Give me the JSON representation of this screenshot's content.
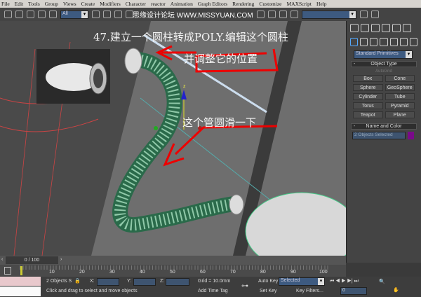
{
  "menu": [
    "File",
    "Edit",
    "Tools",
    "Group",
    "Views",
    "Create",
    "Modifiers",
    "Character",
    "reactor",
    "Animation",
    "Graph Editors",
    "Rendering",
    "Customize",
    "MAXScript",
    "Help"
  ],
  "toolbar": {
    "selection_filter": "All",
    "watermark": "思缘设计论坛 WWW.MISSYUAN.COM"
  },
  "viewport": {
    "note1": "47.建立一个圆柱转成POLY.编辑这个圆柱",
    "note2": "并调整它的位置",
    "note3": "这个管圆滑一下",
    "gizmo_z": "z"
  },
  "panel": {
    "category": "Standard Primitives",
    "object_type_title": "Object Type",
    "autogrid": "AutoGrid",
    "buttons": [
      "Box",
      "Cone",
      "Sphere",
      "GeoSphere",
      "Cylinder",
      "Tube",
      "Torus",
      "Pyramid",
      "Teapot",
      "Plane"
    ],
    "name_color_title": "Name and Color",
    "name_value": "2 Objects Selected",
    "object_color": "#7a0a8a"
  },
  "timeline": {
    "frame": "0 / 100",
    "ticks": [
      "10",
      "20",
      "30",
      "40",
      "50",
      "60",
      "70",
      "80",
      "90",
      "100"
    ]
  },
  "status": {
    "selection": "2 Objects S",
    "x_label": "X:",
    "y_label": "Y:",
    "z_label": "Z:",
    "grid": "Grid = 10.0mm",
    "prompt": "Click and drag to select and move objects",
    "add_time_tag": "Add Time Tag",
    "auto_key": "Auto Key",
    "key_mode": "Selected",
    "set_key": "Set Key",
    "key_filters": "Key Filters...",
    "current_frame": "0"
  }
}
